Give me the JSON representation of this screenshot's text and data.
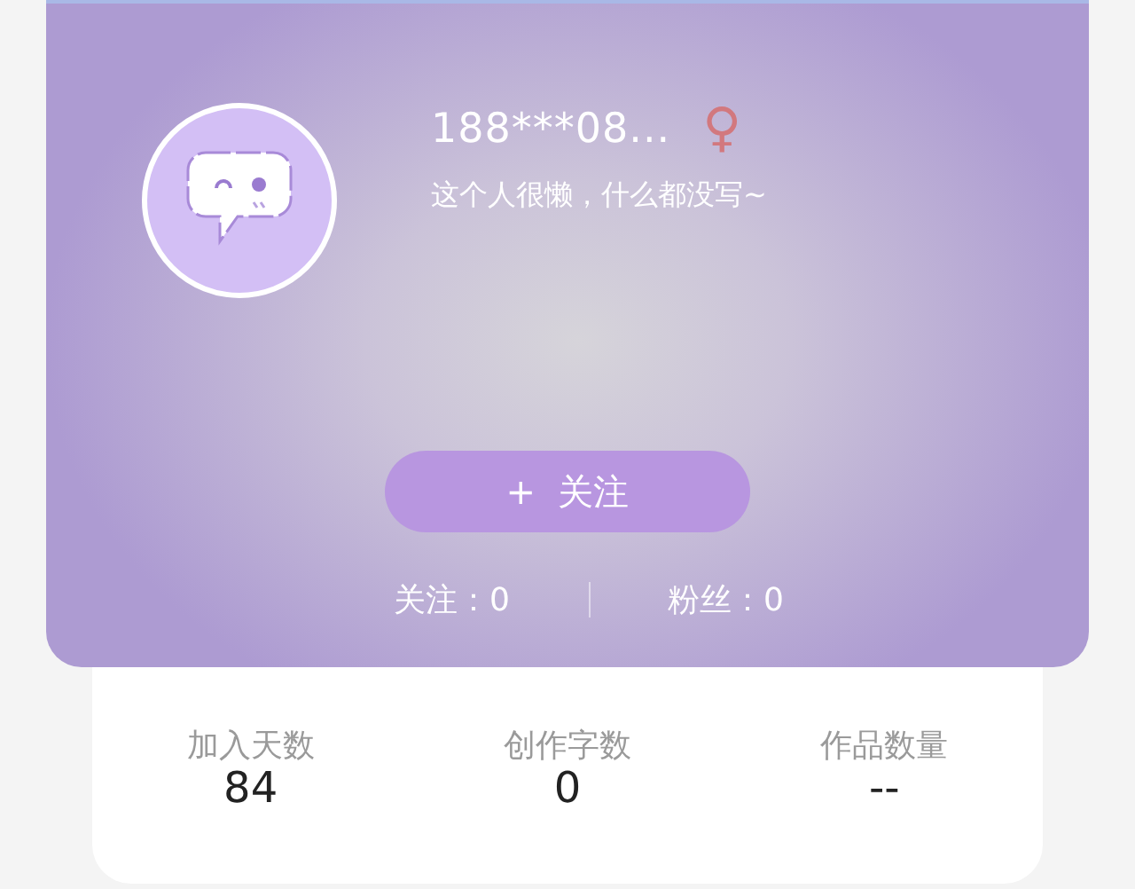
{
  "profile": {
    "name": "188***08...",
    "gender_symbol": "♀",
    "bio": "这个人很懒，什么都没写~"
  },
  "follow_button": {
    "label": "+  关注"
  },
  "social": [
    "关注：0",
    "粉丝：0"
  ],
  "stats": [
    {
      "label": "加入天数",
      "value": "84"
    },
    {
      "label": "创作字数",
      "value": "0"
    },
    {
      "label": "作品数量",
      "value": "--"
    }
  ]
}
